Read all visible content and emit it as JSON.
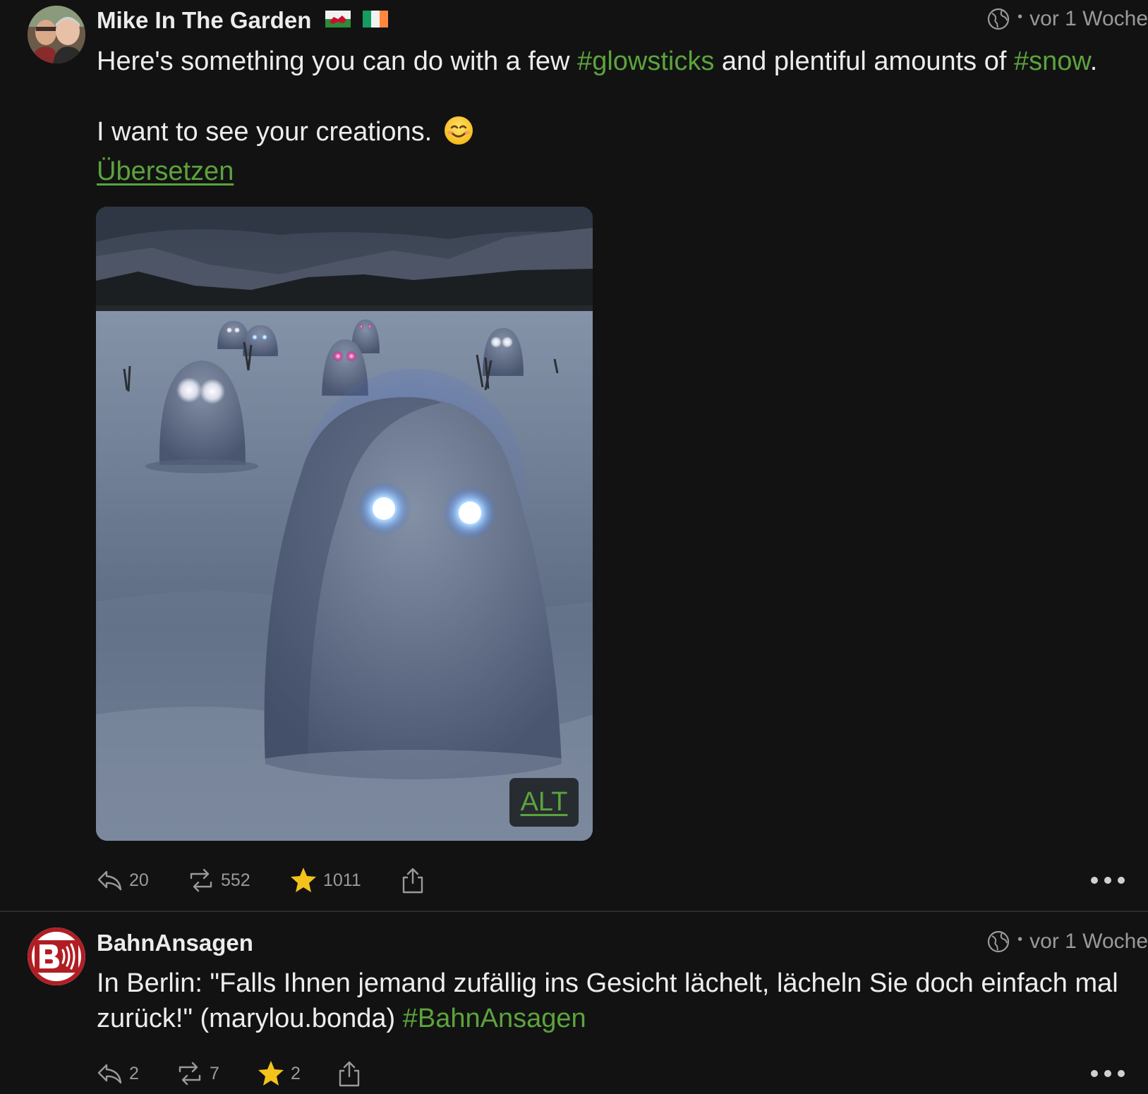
{
  "posts": [
    {
      "author": "Mike In The Garden",
      "time": "vor 1 Woche",
      "text": {
        "line1_pre": "Here's something you can do with a few ",
        "tag1": "#glowsticks",
        "line1_mid": " and plentiful amounts of ",
        "tag2": "#snow",
        "line1_end": ".",
        "line2": "I want to see your creations."
      },
      "translate_label": "Übersetzen",
      "media": {
        "alt_label": "ALT"
      },
      "actions": {
        "replies": "20",
        "boosts": "552",
        "favourites": "1011"
      }
    },
    {
      "author": "BahnAnsagen",
      "time": "vor 1 Woche",
      "text": {
        "line1": "In Berlin: \"Falls Ihnen jemand zufällig ins Gesicht lächelt, lächeln Sie doch einfach mal",
        "line2_pre": "zurück!\" (marylou.bonda) ",
        "tag": "#BahnAnsagen"
      },
      "actions": {
        "replies": "2",
        "boosts": "7",
        "favourites": "2"
      }
    }
  ],
  "colors": {
    "background": "#121212",
    "accent": "#5ca33d",
    "muted": "#9a9a9a",
    "star": "#f4c21b"
  }
}
